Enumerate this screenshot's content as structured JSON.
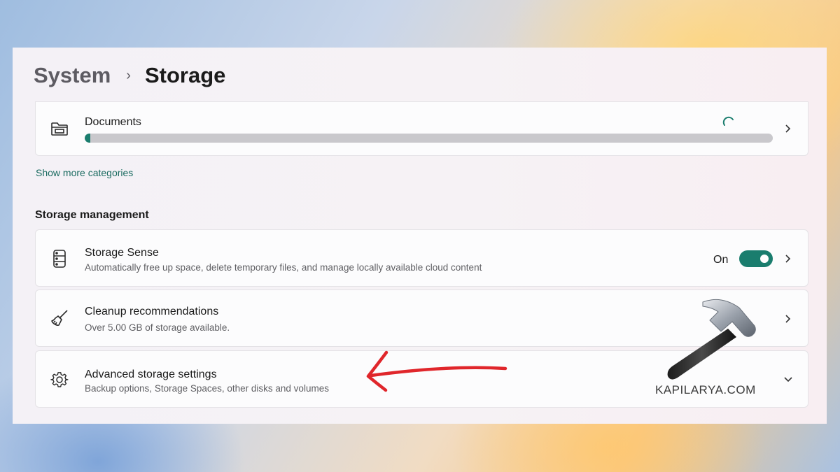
{
  "breadcrumb": {
    "parent": "System",
    "separator": "›",
    "current": "Storage"
  },
  "documents": {
    "title": "Documents",
    "usage_fraction": 0.008,
    "accent": "#1a7d6e"
  },
  "show_more_link": "Show more categories",
  "storage_management": {
    "heading": "Storage management",
    "storage_sense": {
      "title": "Storage Sense",
      "subtitle": "Automatically free up space, delete temporary files, and manage locally available cloud content",
      "toggle_label": "On",
      "toggle_on": true
    },
    "cleanup": {
      "title": "Cleanup recommendations",
      "subtitle": "Over 5.00 GB of storage available."
    },
    "advanced": {
      "title": "Advanced storage settings",
      "subtitle": "Backup options, Storage Spaces, other disks and volumes"
    }
  },
  "icons": {
    "documents": "folder-icon",
    "storage_sense": "drive-icon",
    "cleanup": "broom-icon",
    "advanced": "gear-icon",
    "watermark_logo": "hammer-icon"
  },
  "watermark": "KAPILARYA.COM",
  "annotation": {
    "type": "red-arrow",
    "color": "#e0262b"
  }
}
